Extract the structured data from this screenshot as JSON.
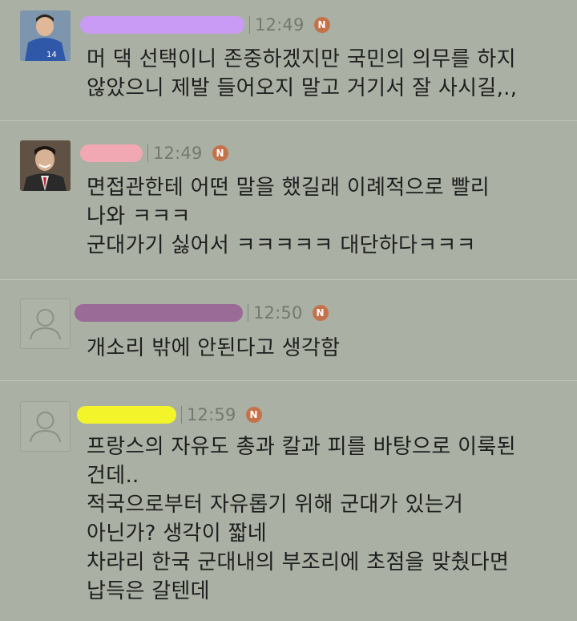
{
  "comments": [
    {
      "avatar_type": "photo",
      "time": "12:49",
      "badge": "N",
      "name_redaction_color": "#c99bf5",
      "text": "머 댁 선택이니 존중하겠지만 국민의 의무를 하지\n않았으니 제발 들어오지 말고 거기서 잘 사시길,.,"
    },
    {
      "avatar_type": "photo",
      "time": "12:49",
      "badge": "N",
      "name_redaction_color": "#f2a8b2",
      "text": "면접관한테 어떤 말을 했길래 이례적으로 빨리\n나와 ㅋㅋㅋ\n군대가기 싫어서 ㅋㅋㅋㅋㅋ 대단하다ㅋㅋㅋ"
    },
    {
      "avatar_type": "default-user-icon",
      "time": "12:50",
      "badge": "N",
      "name_redaction_color": "#9a6b96",
      "text": "개소리 밖에 안된다고 생각함"
    },
    {
      "avatar_type": "default-user-icon",
      "time": "12:59",
      "badge": "N",
      "name_redaction_color": "#f3f52a",
      "text": "프랑스의 자유도 총과 칼과 피를 바탕으로 이룩된\n건데..\n적국으로부터 자유롭기 위해 군대가 있는거\n아닌가? 생각이 짧네\n차라리 한국 군대내의 부조리에 초점을 맞췄다면\n납득은 갈텐데"
    }
  ],
  "colors": {
    "background": "#aab0a4",
    "badge": "#c4724a",
    "time_text": "#74796f",
    "body_text": "#1e1e1e"
  }
}
